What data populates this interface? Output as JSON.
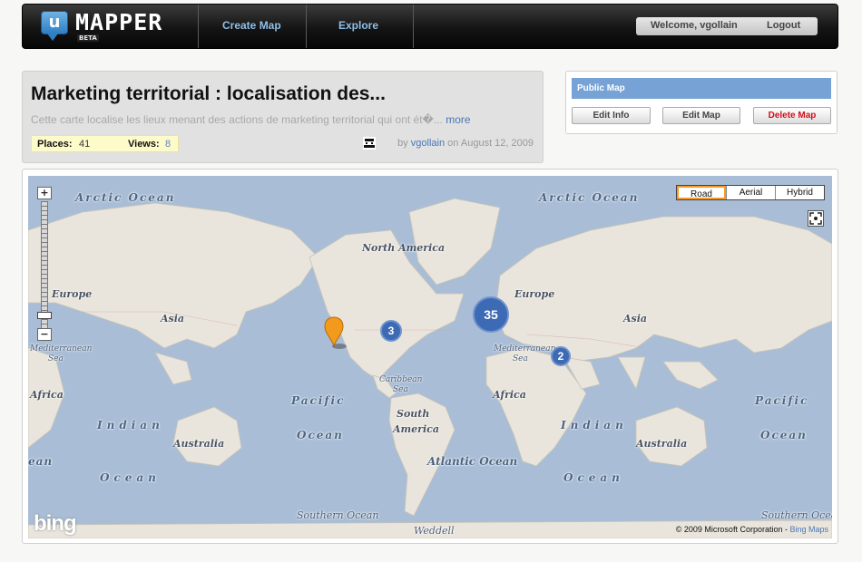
{
  "header": {
    "logo_letter": "u",
    "logo_text": "MAPPER",
    "logo_badge": "BETA",
    "nav": [
      "Create Map",
      "Explore"
    ],
    "welcome": "Welcome, vgollain",
    "logout": "Logout"
  },
  "map_info": {
    "title": "Marketing territorial : localisation des...",
    "description": "Cette carte localise les lieux menant des actions de marketing territorial qui ont ét\u0000...",
    "description_text": "Cette carte localise les lieux menant des actions de marketing territorial qui ont ét�...",
    "more": "more",
    "places_label": "Places:",
    "places_value": "41",
    "views_label": "Views:",
    "views_value": "8",
    "by": "by",
    "author": "vgollain",
    "on": "on",
    "date": "August 12, 2009"
  },
  "actions": {
    "status": "Public Map",
    "edit_info": "Edit Info",
    "edit_map": "Edit Map",
    "delete_map": "Delete Map"
  },
  "map": {
    "zoom_in": "+",
    "zoom_out": "−",
    "map_types": [
      "Road",
      "Aerial",
      "Hybrid"
    ],
    "active_type": "Road",
    "clusters": [
      "3",
      "35",
      "2"
    ],
    "labels": {
      "arctic_left": "Arctic Ocean",
      "arctic_right": "Arctic Ocean",
      "north_america": "North America",
      "europe_left": "Europe",
      "europe_right": "Europe",
      "asia_left": "Asia",
      "asia_right": "Asia",
      "med_left_1": "Mediterranean",
      "med_left_2": "Sea",
      "med_right_1": "Mediterranean",
      "med_right_2": "Sea",
      "africa_left": "Africa",
      "africa_right": "Africa",
      "caribbean_1": "Caribbean",
      "caribbean_2": "Sea",
      "south_america_1": "South",
      "south_america_2": "America",
      "pacific_left_1": "Pacific",
      "pacific_left_2": "Ocean",
      "pacific_right_1": "Pacific",
      "pacific_right_2": "Ocean",
      "indian_left_1": "Indian",
      "indian_left_2": "Ocean",
      "indian_right_1": "Indian",
      "indian_right_2": "Ocean",
      "australia_left": "Australia",
      "australia_right": "Australia",
      "atlantic": "Atlantic Ocean",
      "southern_left": "Southern Ocean",
      "southern_right": "Southern Ocean",
      "weddell": "Weddell",
      "edge_ean": "ean"
    },
    "provider_logo": "bing",
    "copyright": "© 2009 Microsoft Corporation - ",
    "copyright_link": "Bing Maps"
  },
  "colors": {
    "water": "#a9bed6",
    "land": "#e9e5dc",
    "cluster": "#3d6ab4",
    "pin": "#f29a1c",
    "public_bar": "#76a2d6",
    "delete": "#d0101c"
  }
}
